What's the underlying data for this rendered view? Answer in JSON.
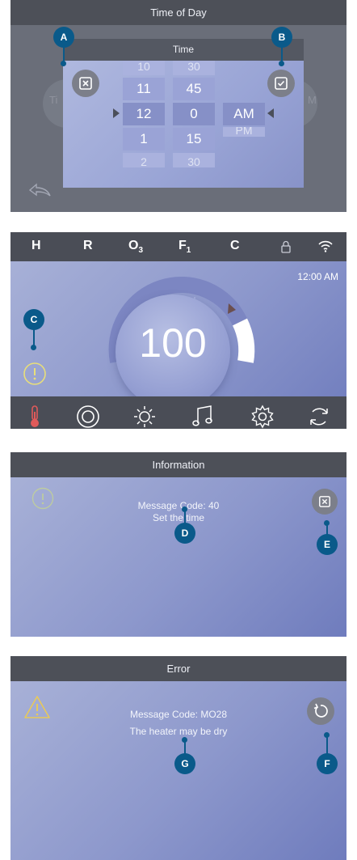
{
  "callouts": {
    "a": "A",
    "b": "B",
    "c": "C",
    "d": "D",
    "e": "E",
    "f": "F",
    "g": "G"
  },
  "time_screen": {
    "title": "Time of Day",
    "dialog_title": "Time",
    "ghost_left": "Ti",
    "ghost_right": "M",
    "hours": [
      "10",
      "11",
      "12",
      "1",
      "2"
    ],
    "minutes": [
      "30",
      "45",
      "0",
      "15",
      "30"
    ],
    "ampm": [
      "AM",
      "PM"
    ],
    "cancel_icon": "close-box-icon",
    "confirm_icon": "check-box-icon",
    "back_icon": "back-arrow-icon"
  },
  "main_screen": {
    "status": {
      "h": "H",
      "r": "R",
      "o": "O",
      "o_sub": "3",
      "f": "F",
      "f_sub": "1",
      "c": "C"
    },
    "lock_icon": "lock-icon",
    "wifi_icon": "wifi-icon",
    "clock": "12:00 AM",
    "temperature": "100",
    "info_icon": "info-icon",
    "nav": [
      "thermometer-icon",
      "jets-icon",
      "light-icon",
      "music-icon",
      "settings-icon",
      "refresh-icon"
    ],
    "colors": {
      "gauge_arc": "#7c86c2",
      "gauge_end": "#ffffff",
      "gauge_marker": "#6b4f4f",
      "thermometer": "#e05a5a"
    }
  },
  "info_screen": {
    "title": "Information",
    "message_code": "Message Code: 40",
    "message": "Set the time",
    "info_icon": "info-icon",
    "close_icon": "close-box-icon"
  },
  "error_screen": {
    "title": "Error",
    "message_code": "Message Code: MO28",
    "message": "The heater may be dry",
    "warning_icon": "warning-icon",
    "reset_icon": "reset-icon",
    "colors": {
      "warning": "#e8c95a"
    }
  }
}
